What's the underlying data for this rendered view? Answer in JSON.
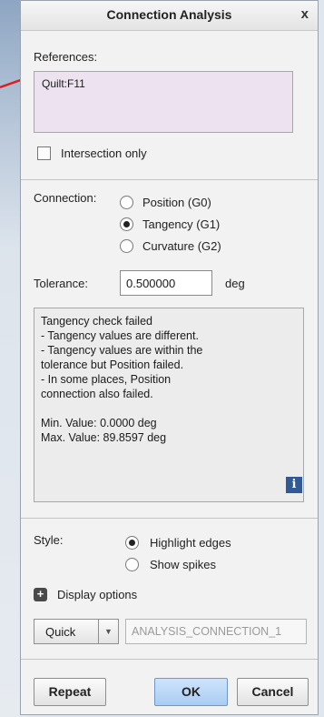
{
  "window": {
    "title": "Connection Analysis",
    "close_glyph": "x"
  },
  "references": {
    "label": "References:",
    "items": [
      "Quilt:F11"
    ],
    "intersection_only_label": "Intersection only",
    "intersection_only_checked": false
  },
  "connection": {
    "label": "Connection:",
    "options": [
      "Position (G0)",
      "Tangency (G1)",
      "Curvature (G2)"
    ],
    "selected": "Tangency (G1)"
  },
  "tolerance": {
    "label": "Tolerance:",
    "value": "0.500000",
    "unit": "deg"
  },
  "results": {
    "lines": [
      "Tangency check failed",
      "- Tangency values are different.",
      "- Tangency values are within the",
      "tolerance but Position failed.",
      "- In some places, Position",
      "connection also failed.",
      "",
      "Min.  Value: 0.0000 deg",
      "Max. Value: 89.8597 deg"
    ],
    "info_icon": "info-icon"
  },
  "style": {
    "label": "Style:",
    "options": [
      "Highlight edges",
      "Show spikes"
    ],
    "selected": "Highlight edges"
  },
  "display_options": {
    "label": "Display options",
    "icon": "plus-icon"
  },
  "analysis": {
    "mode": "Quick",
    "name_placeholder": "ANALYSIS_CONNECTION_1"
  },
  "buttons": {
    "repeat": "Repeat",
    "ok": "OK",
    "cancel": "Cancel"
  },
  "colors": {
    "ok_button": "#a9ccf2",
    "references_bg": "#ece2f0",
    "info_icon": "#2f5a94"
  }
}
